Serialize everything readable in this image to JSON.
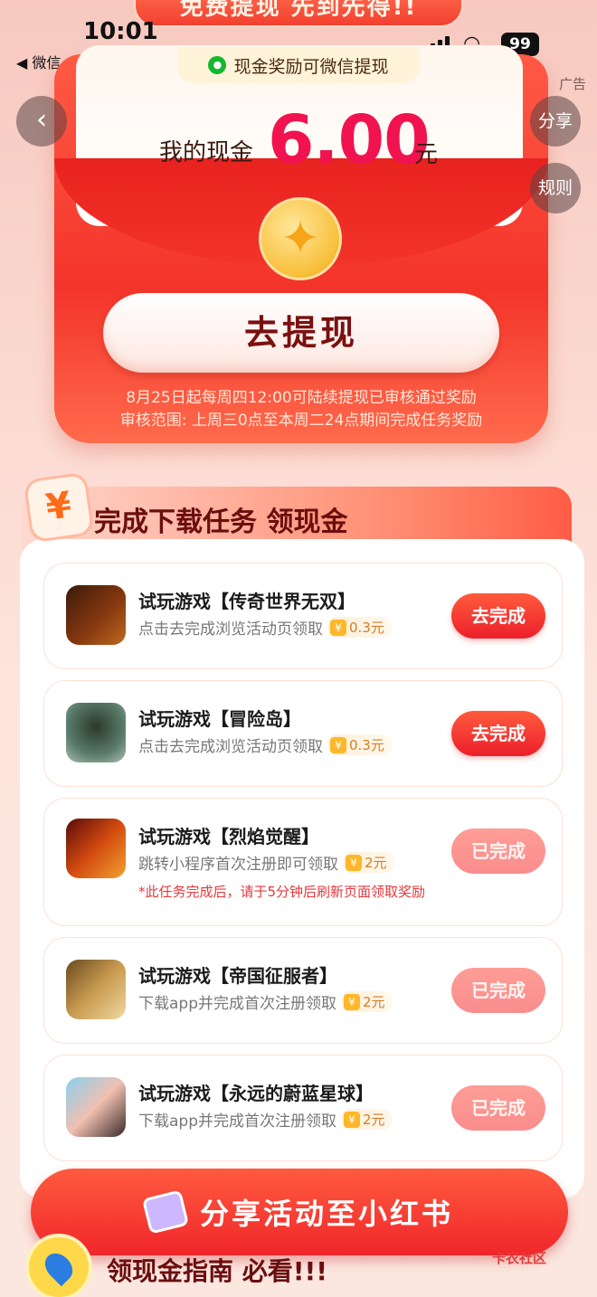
{
  "status_bar": {
    "time": "10:01",
    "back_app": "微信",
    "battery": "99"
  },
  "top_banner": "免费提现 先到先得!!",
  "envelope": {
    "wechat_notice": "现金奖励可微信提现",
    "cash_label": "我的现金",
    "cash_value": "6.00",
    "cash_unit": "元",
    "cta": "去提现",
    "rules": [
      "8月25日起每周四12:00可陆续提现已审核通过奖励",
      "审核范围: 上周三0点至本周二24点期间完成任务奖励"
    ]
  },
  "side_buttons": {
    "ad": "广告",
    "share": "分享",
    "rules": "规则"
  },
  "task_section": {
    "title": "完成下载任务 领现金",
    "tasks": [
      {
        "title": "试玩游戏【传奇世界无双】",
        "desc": "点击去完成浏览活动页领取",
        "reward": "0.3元",
        "button": "去完成",
        "state": "todo"
      },
      {
        "title": "试玩游戏【冒险岛】",
        "desc": "点击去完成浏览活动页领取",
        "reward": "0.3元",
        "button": "去完成",
        "state": "todo"
      },
      {
        "title": "试玩游戏【烈焰觉醒】",
        "desc": "跳转小程序首次注册即可领取",
        "reward": "2元",
        "button": "已完成",
        "state": "done",
        "note": "*此任务完成后，请于5分钟后刷新页面领取奖励"
      },
      {
        "title": "试玩游戏【帝国征服者】",
        "desc": "下载app并完成首次注册领取",
        "reward": "2元",
        "button": "已完成",
        "state": "done"
      },
      {
        "title": "试玩游戏【永远的蔚蓝星球】",
        "desc": "下载app并完成首次注册领取",
        "reward": "2元",
        "button": "已完成",
        "state": "done"
      }
    ]
  },
  "share_button": "分享活动至小红书",
  "guide_title": "领现金指南 必看!!!",
  "watermark": "卡农社区",
  "colors": {
    "accent": "#f0134f",
    "primary_red": "#ec1f2a",
    "done_pink": "#f98d8d",
    "reward_gold": "#ffb72a"
  }
}
